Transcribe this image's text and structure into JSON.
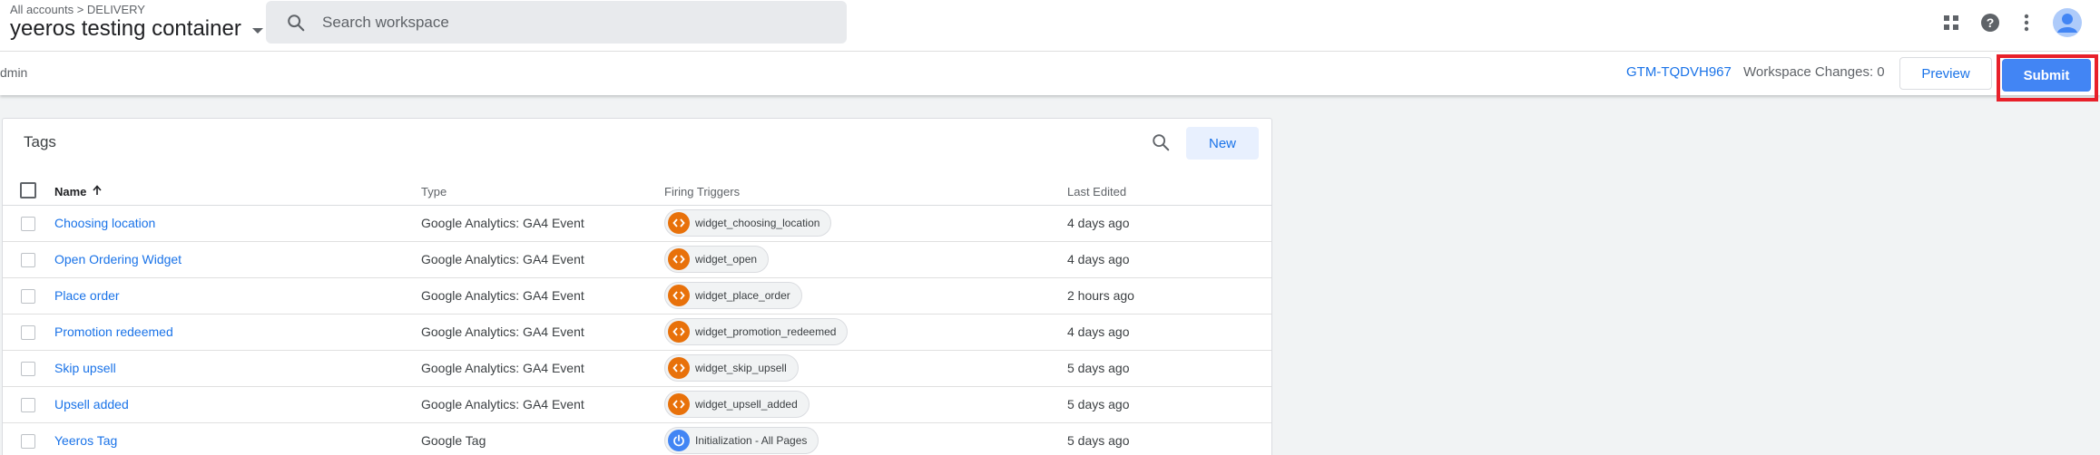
{
  "header": {
    "breadcrumb": "All accounts > DELIVERY",
    "container_name": "yeeros testing container",
    "search_placeholder": "Search workspace"
  },
  "top_icons": [
    "apps-grid-icon",
    "help-icon",
    "more-vert-icon",
    "account-avatar-icon"
  ],
  "subbar": {
    "left_tab": "dmin",
    "gtm_id": "GTM-TQDVH967",
    "workspace_changes": "Workspace Changes: 0",
    "preview_label": "Preview",
    "submit_label": "Submit"
  },
  "tags": {
    "title": "Tags",
    "new_label": "New",
    "columns": {
      "name": "Name",
      "type": "Type",
      "triggers": "Firing Triggers",
      "last_edited": "Last Edited"
    },
    "rows": [
      {
        "name": "Choosing location",
        "type": "Google Analytics: GA4 Event",
        "trigger": "widget_choosing_location",
        "trigger_icon": "custom-event-icon",
        "edited": "4 days ago"
      },
      {
        "name": "Open Ordering Widget",
        "type": "Google Analytics: GA4 Event",
        "trigger": "widget_open",
        "trigger_icon": "custom-event-icon",
        "edited": "4 days ago"
      },
      {
        "name": "Place order",
        "type": "Google Analytics: GA4 Event",
        "trigger": "widget_place_order",
        "trigger_icon": "custom-event-icon",
        "edited": "2 hours ago"
      },
      {
        "name": "Promotion redeemed",
        "type": "Google Analytics: GA4 Event",
        "trigger": "widget_promotion_redeemed",
        "trigger_icon": "custom-event-icon",
        "edited": "4 days ago"
      },
      {
        "name": "Skip upsell",
        "type": "Google Analytics: GA4 Event",
        "trigger": "widget_skip_upsell",
        "trigger_icon": "custom-event-icon",
        "edited": "5 days ago"
      },
      {
        "name": "Upsell added",
        "type": "Google Analytics: GA4 Event",
        "trigger": "widget_upsell_added",
        "trigger_icon": "custom-event-icon",
        "edited": "5 days ago"
      },
      {
        "name": "Yeeros Tag",
        "type": "Google Tag",
        "trigger": "Initialization - All Pages",
        "trigger_icon": "power-icon",
        "edited": "5 days ago"
      }
    ]
  },
  "colors": {
    "accent": "#1a73e8",
    "submit": "#4285f4",
    "highlight": "#e8202a",
    "event_trigger": "#e8710a",
    "init_trigger": "#4285f4"
  }
}
